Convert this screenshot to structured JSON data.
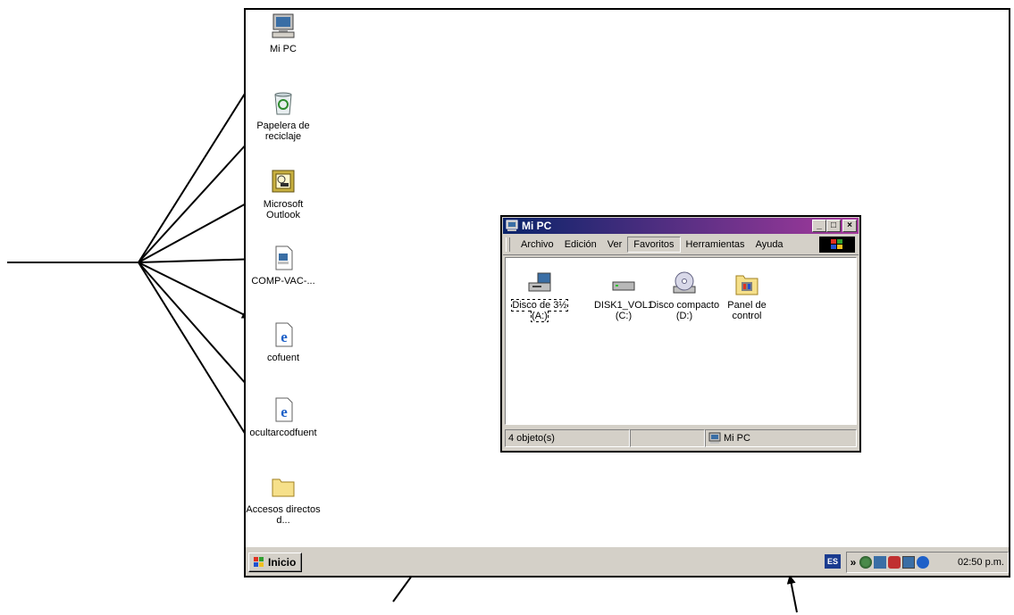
{
  "desktop": {
    "icons": [
      {
        "name": "mi-pc",
        "label": "Mi PC"
      },
      {
        "name": "papelera",
        "label": "Papelera de reciclaje"
      },
      {
        "name": "outlook",
        "label": "Microsoft Outlook"
      },
      {
        "name": "comp-vac",
        "label": "COMP-VAC-..."
      },
      {
        "name": "cofuent",
        "label": "cofuent"
      },
      {
        "name": "ocultarcodfuent",
        "label": "ocultarcodfuent"
      },
      {
        "name": "accesos",
        "label": "Accesos directos d..."
      }
    ]
  },
  "window": {
    "title": "Mi PC",
    "menu": [
      "Archivo",
      "Edición",
      "Ver",
      "Favoritos",
      "Herramientas",
      "Ayuda"
    ],
    "items": [
      {
        "label": "Disco de 3½ (A:)",
        "icon": "floppy-drive-icon"
      },
      {
        "label": "DISK1_VOL1 (C:)",
        "icon": "hard-drive-icon"
      },
      {
        "label": "Disco compacto (D:)",
        "icon": "cd-drive-icon"
      },
      {
        "label": "Panel de control",
        "icon": "control-panel-icon"
      }
    ],
    "status": {
      "count": "4 objeto(s)",
      "location": "Mi PC"
    }
  },
  "taskbar": {
    "start_label": "Inicio",
    "lang": "ES",
    "chevron": "»",
    "clock": "02:50 p.m."
  },
  "colors": {
    "titlebar_start": "#0a246a",
    "titlebar_end": "#a63a9d",
    "taskbar": "#d4d0c8"
  }
}
